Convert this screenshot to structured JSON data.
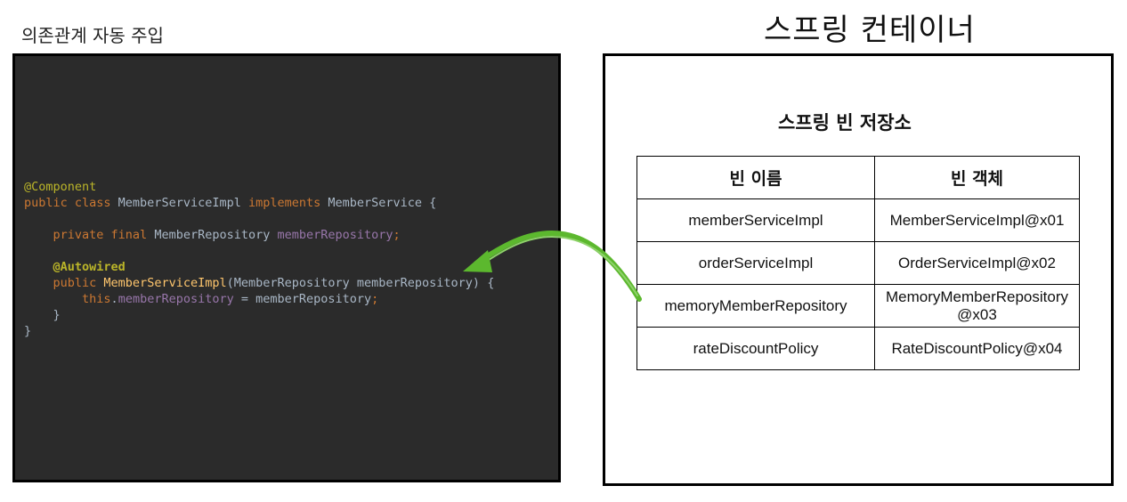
{
  "left_title": "의존관계 자동 주입",
  "right_title": "스프링 컨테이너",
  "code": {
    "line1": "@Component",
    "line2_kw1": "public class ",
    "line2_cls": "MemberServiceImpl ",
    "line2_kw2": "implements ",
    "line2_iface": "MemberService {",
    "line3_kw": "private final ",
    "line3_type": "MemberRepository ",
    "line3_field": "memberRepository",
    "line3_end": ";",
    "line4": "@Autowired",
    "line5_kw": "public ",
    "line5_fn": "MemberServiceImpl",
    "line5_args": "(MemberRepository memberRepository) {",
    "line6_this": "this",
    "line6_dot": ".",
    "line6_field": "memberRepository",
    "line6_rest": " = memberRepository",
    "line6_end": ";",
    "line7": "}",
    "line8": "}"
  },
  "storage": {
    "title": "스프링 빈 저장소",
    "header_name": "빈 이름",
    "header_object": "빈 객체",
    "rows": [
      {
        "name": "memberServiceImpl",
        "object": "MemberServiceImpl@x01"
      },
      {
        "name": "orderServiceImpl",
        "object": "OrderServiceImpl@x02"
      },
      {
        "name": "memoryMemberRepository",
        "object_line1": "MemoryMemberRepository",
        "object_line2": "@x03"
      },
      {
        "name": "rateDiscountPolicy",
        "object": "RateDiscountPolicy@x04"
      }
    ]
  },
  "colors": {
    "code_bg": "#2b2b2b",
    "annotation": "#bbb529",
    "keyword": "#cc7832",
    "field": "#9876aa",
    "method": "#ffc66d",
    "arrow": "#5cb82e"
  },
  "icons": {
    "arrow": "green-curved-arrow"
  }
}
